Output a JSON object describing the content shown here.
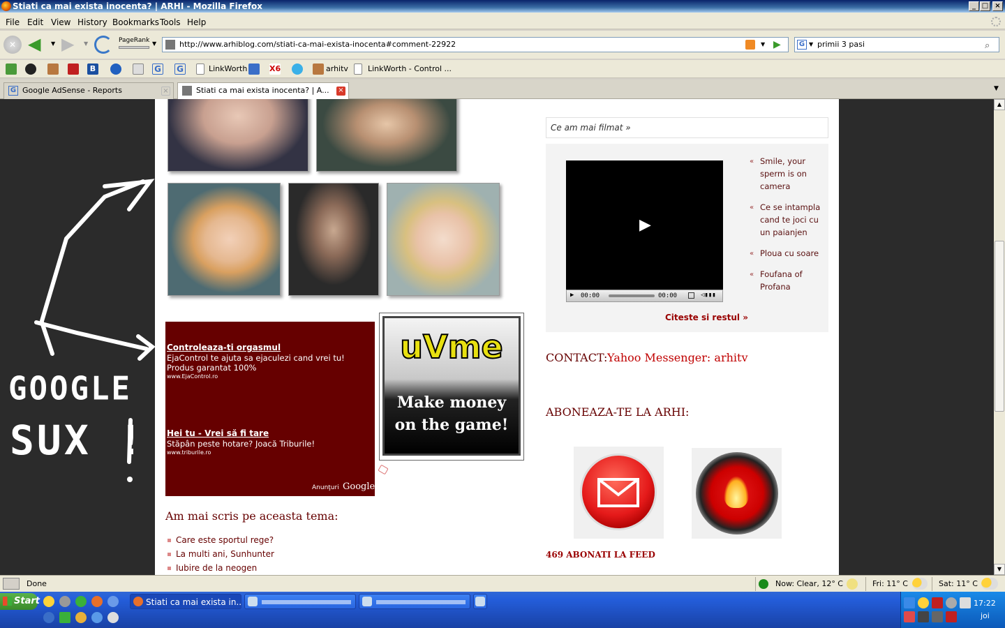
{
  "window": {
    "title": "Stiati ca mai exista inocenta? | ARHI - Mozilla Firefox",
    "controls": [
      "_",
      "□",
      "×"
    ]
  },
  "menubar": {
    "items": [
      "File",
      "Edit",
      "View",
      "History",
      "Bookmarks",
      "Tools",
      "Help"
    ]
  },
  "navbar": {
    "pagerank_label": "PageRank",
    "url": "http://www.arhiblog.com/stiati-ca-mai-exista-inocenta#comment-22922",
    "search_value": "primii 3 pasi"
  },
  "bookmarks": {
    "items": [
      "LinkWorth",
      "arhitv",
      "LinkWorth - Control ..."
    ]
  },
  "tabs": [
    {
      "label": "Google AdSense - Reports",
      "active": false
    },
    {
      "label": "Stiati ca mai exista inocenta? | A...",
      "active": true
    }
  ],
  "left_panel": {
    "graffiti_line1": "GOOGLE",
    "graffiti_line2": "SUX !"
  },
  "content": {
    "ads": {
      "ad1_title": "Controleaza-ti orgasmul",
      "ad1_desc": "EjaControl te ajuta sa ejaculezi cand vrei tu! Produs garantat 100%",
      "ad1_url": "www.EjaControl.ro",
      "ad2_title": "Hei tu - Vrei să fi tare",
      "ad2_desc": "Stăpân peste hotare? Joacă Triburile!",
      "ad2_url": "www.triburile.ro",
      "ad_footer_prefix": "Anunţuri",
      "ad_footer_brand": "Google"
    },
    "banner": {
      "logo": "uVme",
      "line1": "Make money",
      "line2": "on the game!"
    },
    "related": {
      "heading": "Am mai scris pe aceasta tema:",
      "items": [
        "Care este sportul rege?",
        "La multi ani, Sunhunter",
        "Iubire de la neogen"
      ]
    }
  },
  "sidebar": {
    "filmat_heading": "Ce am mai filmat »",
    "video": {
      "time_current": "00:00",
      "time_total": "00:00"
    },
    "video_list": [
      "Smile, your sperm is on camera",
      "Ce se intampla cand te joci cu un paianjen",
      "Ploua cu soare",
      "Foufana of Profana"
    ],
    "read_more": "Citeste si restul »",
    "contact_label": "CONTACT:",
    "contact_value": "Yahoo Messenger: arhitv",
    "subscribe_heading": "ABONEAZA-TE LA ARHI:",
    "subscribers": "469 ABONATI LA FEED"
  },
  "statusbar": {
    "status": "Done",
    "weather_now": "Now: Clear, 12° C",
    "weather_fri": "Fri: 11° C",
    "weather_sat": "Sat: 11° C"
  },
  "taskbar": {
    "start_label": "Start",
    "active_window": "Stiati ca mai exista in...",
    "clock_time": "17:22",
    "clock_day": "joi"
  },
  "colors": {
    "ad_background": "#660000",
    "accent_red": "#c00000",
    "dark_red": "#5a1010"
  }
}
